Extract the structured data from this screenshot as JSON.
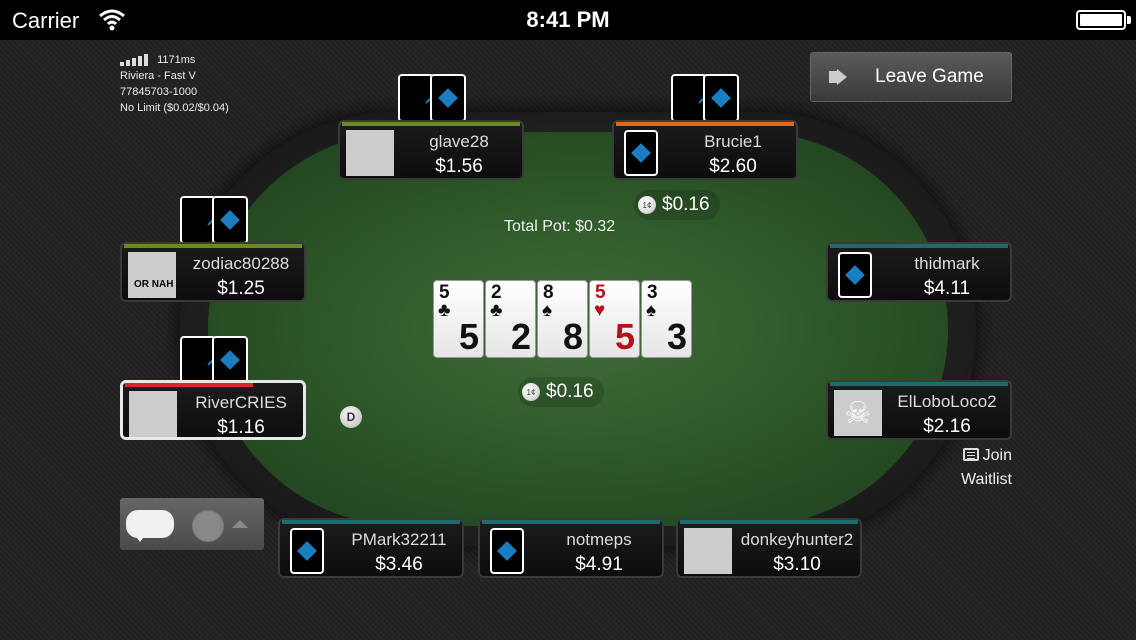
{
  "status_bar": {
    "carrier": "Carrier",
    "time": "8:41 PM"
  },
  "info": {
    "latency": "1171ms",
    "table_name": "Riviera - Fast V",
    "game_id": "77845703-1000",
    "limits": "No Limit ($0.02/$0.04)"
  },
  "leave_button": {
    "label": "Leave Game"
  },
  "pot": {
    "total_label": "Total Pot: $0.32"
  },
  "bets": {
    "top": "$0.16",
    "center": "$0.16"
  },
  "dealer_button": {
    "label": "D"
  },
  "chip_label": "1¢",
  "board": [
    {
      "rank": "5",
      "suit": "♣",
      "color": "black"
    },
    {
      "rank": "2",
      "suit": "♣",
      "color": "black"
    },
    {
      "rank": "8",
      "suit": "♠",
      "color": "black"
    },
    {
      "rank": "5",
      "suit": "♥",
      "color": "red"
    },
    {
      "rank": "3",
      "suit": "♠",
      "color": "black"
    }
  ],
  "seats": [
    {
      "name": "glave28",
      "stack": "$1.56",
      "bar_color": "#6a8a22"
    },
    {
      "name": "Brucie1",
      "stack": "$2.60",
      "bar_color": "#e06a1a"
    },
    {
      "name": "zodiac80288",
      "stack": "$1.25",
      "bar_color": "#6a8a22",
      "avatar_text": "OR NAH"
    },
    {
      "name": "thidmark",
      "stack": "$4.11",
      "bar_color": "#1f6a6a"
    },
    {
      "name": "RiverCRIES",
      "stack": "$1.16",
      "bar_color": "#d22a2a"
    },
    {
      "name": "ElLoboLoco2",
      "stack": "$2.16",
      "bar_color": "#1f6a6a"
    },
    {
      "name": "PMark32211",
      "stack": "$3.46",
      "bar_color": "#1f6a6a"
    },
    {
      "name": "notmeps",
      "stack": "$4.91",
      "bar_color": "#1f6a6a"
    },
    {
      "name": "donkeyhunter2",
      "stack": "$3.10",
      "bar_color": "#1f6a6a"
    }
  ],
  "waitlist": {
    "line1": "Join",
    "line2": "Waitlist"
  },
  "colors": {
    "felt": "#2f5a2b",
    "card_back_suit": "#1a7ec0",
    "red_suit": "#b4121a"
  },
  "icons": [
    "wifi-icon",
    "battery-icon",
    "signal-icon",
    "leave-icon",
    "chip-icon",
    "list-icon",
    "chat-bubble-icon",
    "emoji-icon",
    "skull-icon"
  ]
}
